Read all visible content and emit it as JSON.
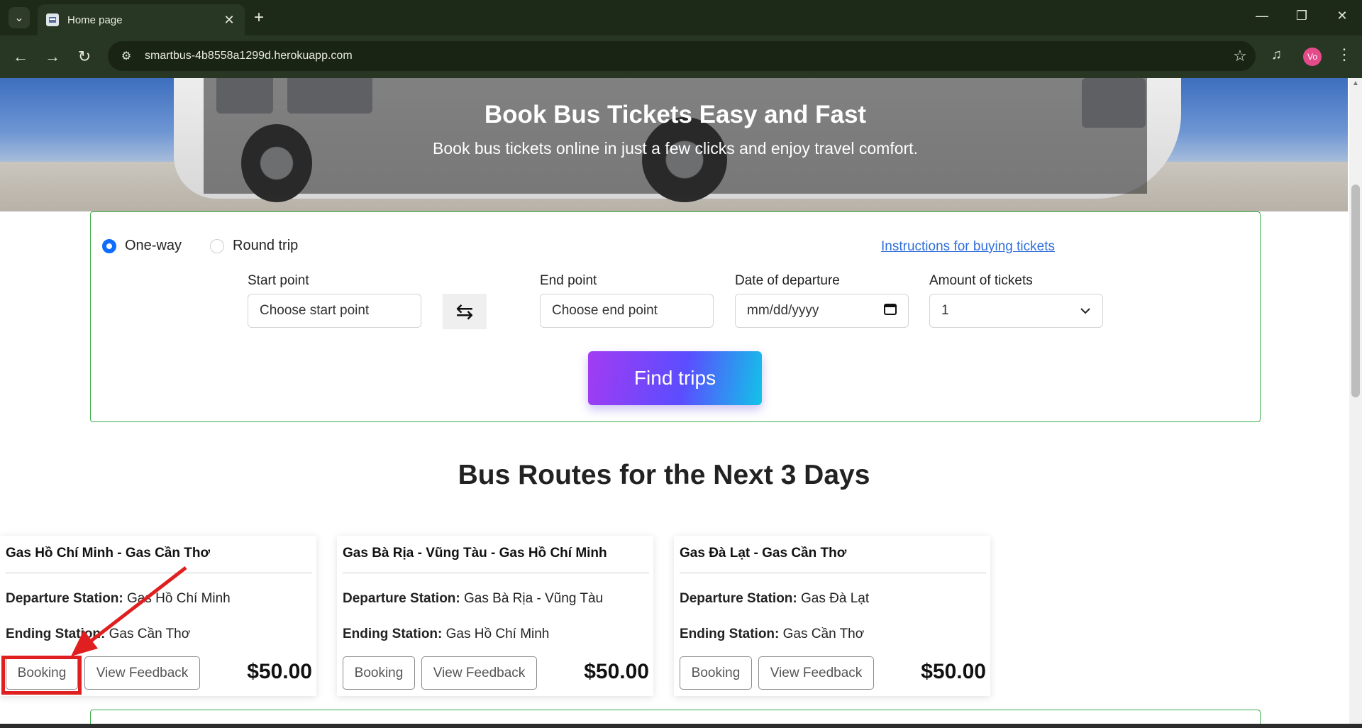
{
  "browser": {
    "tab_title": "Home page",
    "url": "smartbus-4b8558a1299d.herokuapp.com",
    "avatar_initials": "Vo",
    "icons": {
      "tab_dropdown": "chevron-down-icon",
      "new_tab": "plus-icon",
      "back": "arrow-left-icon",
      "forward": "arrow-right-icon",
      "reload": "reload-icon",
      "site_info": "tune-icon",
      "bookmark": "star-icon",
      "media": "media-control-icon",
      "menu": "kebab-menu-icon"
    }
  },
  "hero": {
    "title": "Book Bus Tickets Easy and Fast",
    "subtitle": "Book bus tickets online in just a few clicks and enjoy travel comfort."
  },
  "search": {
    "trip_types": [
      "One-way",
      "Round trip"
    ],
    "selected_trip_type": "One-way",
    "instructions_link": "Instructions for buying tickets",
    "start_label": "Start point",
    "start_placeholder": "Choose start point",
    "end_label": "End point",
    "end_placeholder": "Choose end point",
    "date_label": "Date of departure",
    "date_placeholder": "mm/dd/yyyy",
    "amount_label": "Amount of tickets",
    "amount_value": "1",
    "swap_icon": "swap-arrows-icon",
    "find_button": "Find trips"
  },
  "routes": {
    "section_title": "Bus Routes for the Next 3 Days",
    "departure_label": "Departure Station:",
    "ending_label": "Ending Station:",
    "booking_label": "Booking",
    "feedback_label": "View Feedback",
    "cards": [
      {
        "title": "Gas Hồ Chí Minh - Gas Cần Thơ",
        "departure": "Gas Hồ Chí Minh",
        "ending": "Gas Cần Thơ",
        "price": "$50.00"
      },
      {
        "title": "Gas Bà Rịa - Vũng Tàu - Gas Hồ Chí Minh",
        "departure": "Gas Bà Rịa - Vũng Tàu",
        "ending": "Gas Hồ Chí Minh",
        "price": "$50.00"
      },
      {
        "title": "Gas Đà Lạt - Gas Cần Thơ",
        "departure": "Gas Đà Lạt",
        "ending": "Gas Cần Thơ",
        "price": "$50.00"
      }
    ]
  },
  "colors": {
    "accent_green": "#3eae4c",
    "link_blue": "#2f6fdb",
    "annotation_red": "#e02020"
  }
}
